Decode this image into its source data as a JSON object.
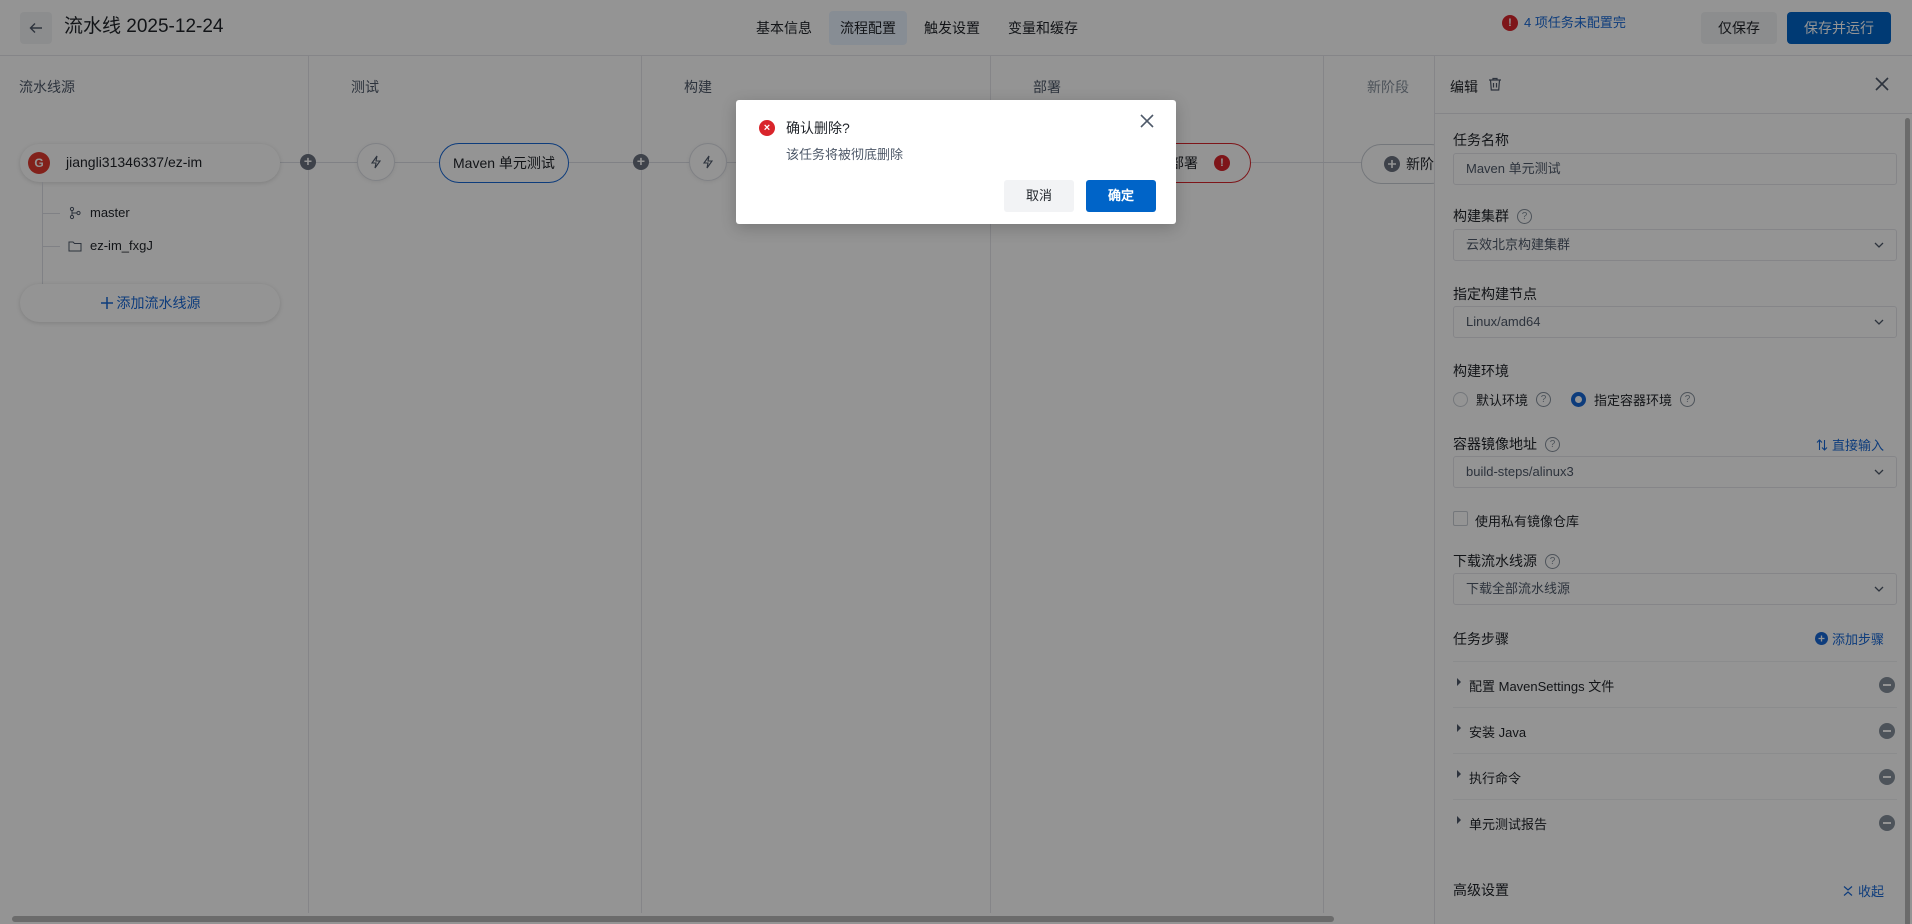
{
  "header": {
    "title": "流水线 2025-12-24",
    "tabs": [
      {
        "label": "基本信息"
      },
      {
        "label": "流程配置"
      },
      {
        "label": "触发设置"
      },
      {
        "label": "变量和缓存"
      }
    ],
    "active_tab": "流程配置",
    "warning": "4 项任务未配置完",
    "save_label": "仅保存",
    "save_run_label": "保存并运行"
  },
  "stages": [
    {
      "title": "流水线源"
    },
    {
      "title": "测试"
    },
    {
      "title": "构建"
    },
    {
      "title": "部署"
    },
    {
      "title": "新阶段"
    }
  ],
  "source": {
    "logo_letter": "G",
    "name": "jiangli31346337/ez-im",
    "branch": "master",
    "folder": "ez-im_fxgJ",
    "add_label": "添加流水线源"
  },
  "tasks": {
    "test_task": "Maven 单元测试",
    "deploy_task": "部署",
    "new_stage_btn": "新阶"
  },
  "panel": {
    "title": "编辑",
    "task_name_label": "任务名称",
    "task_name_value": "Maven 单元测试",
    "cluster_label": "构建集群",
    "cluster_value": "云效北京构建集群",
    "node_label": "指定构建节点",
    "node_value": "Linux/amd64",
    "env_label": "构建环境",
    "env_default": "默认环境",
    "env_container": "指定容器环境",
    "image_label": "容器镜像地址",
    "image_link": "直接输入",
    "image_value": "build-steps/alinux3",
    "private_repo_label": "使用私有镜像仓库",
    "download_label": "下载流水线源",
    "download_value": "下载全部流水线源",
    "steps_label": "任务步骤",
    "add_step_label": "添加步骤",
    "steps": [
      {
        "label": "配置 MavenSettings 文件"
      },
      {
        "label": "安装 Java"
      },
      {
        "label": "执行命令"
      },
      {
        "label": "单元测试报告"
      }
    ],
    "advanced_label": "高级设置",
    "collapse_label": "收起"
  },
  "modal": {
    "title": "确认删除?",
    "description": "该任务将被彻底删除",
    "cancel_label": "取消",
    "ok_label": "确定"
  },
  "colors": {
    "primary": "#0064c8",
    "link": "#1868d6",
    "danger": "#d9252b"
  }
}
